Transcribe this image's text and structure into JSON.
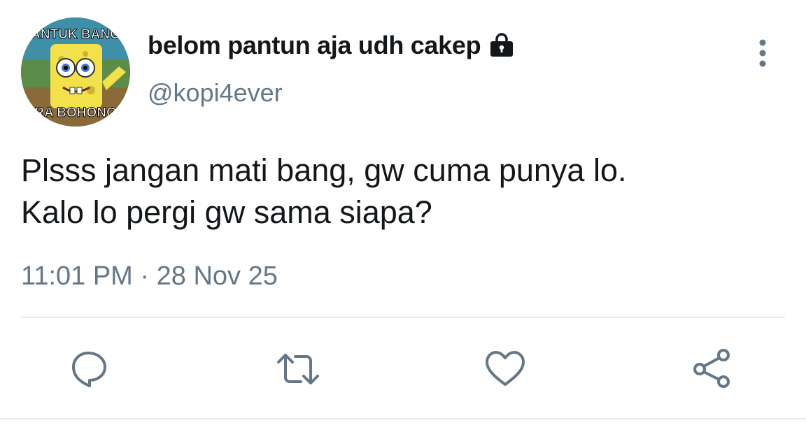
{
  "tweet": {
    "author": {
      "display_name": "belom pantun aja udh cakep",
      "handle": "@kopi4ever",
      "protected_icon": "lock-icon",
      "avatar": {
        "caption_top": "ANTUK BANG",
        "caption_bottom": "RA BOHONG"
      }
    },
    "text_lines": [
      "Plsss jangan mati bang, gw cuma punya lo.",
      "Kalo lo pergi gw sama siapa?"
    ],
    "time": "11:01 PM",
    "separator": "·",
    "date": "28 Nov 25"
  },
  "actions": [
    {
      "name": "reply",
      "icon": "reply-icon"
    },
    {
      "name": "retweet",
      "icon": "retweet-icon"
    },
    {
      "name": "like",
      "icon": "heart-icon"
    },
    {
      "name": "share",
      "icon": "share-icon"
    }
  ],
  "colors": {
    "text_primary": "#14171a",
    "text_secondary": "#657786",
    "icon": "#657786",
    "divider": "#e6ecf0"
  }
}
